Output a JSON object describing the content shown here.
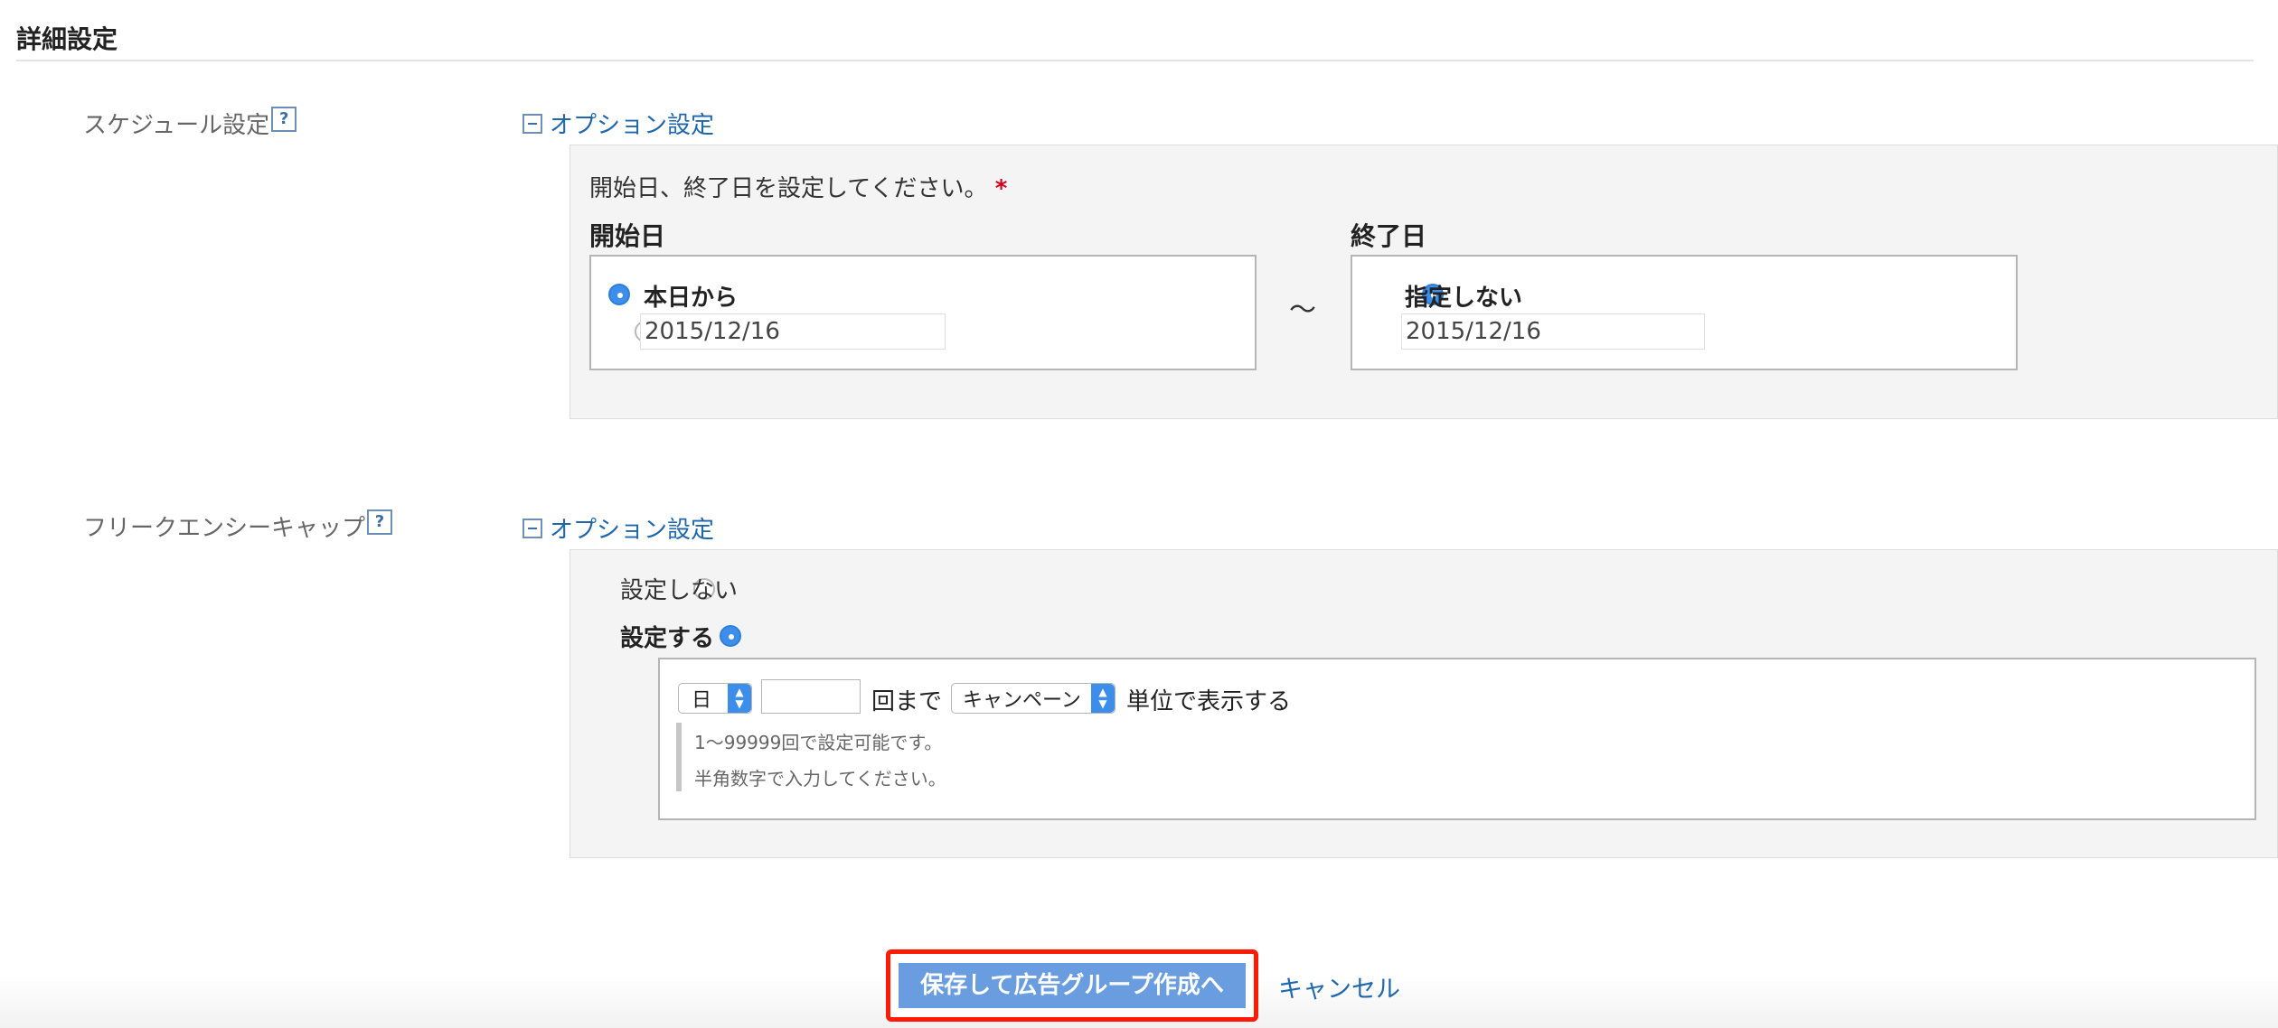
{
  "section_title": "詳細設定",
  "schedule": {
    "label": "スケジュール設定",
    "help": "?",
    "toggle_label": "オプション設定",
    "instruction": "開始日、終了日を設定してください。",
    "required_mark": "*",
    "start": {
      "heading": "開始日",
      "option_today": "本日から",
      "date_value": "2015/12/16",
      "selected": "today"
    },
    "separator": "～",
    "end": {
      "heading": "終了日",
      "option_none": "指定しない",
      "date_value": "2015/12/16",
      "selected": "none"
    }
  },
  "frequency_cap": {
    "label": "フリークエンシーキャップ",
    "help": "?",
    "toggle_label": "オプション設定",
    "option_off": "設定しない",
    "option_on": "設定する",
    "selected": "on",
    "period_select": "日",
    "count_value": "",
    "count_suffix": "回まで",
    "unit_select": "キャンペーン",
    "unit_suffix": "単位で表示する",
    "notes": [
      "1～99999回で設定可能です。",
      "半角数字で入力してください。"
    ]
  },
  "footer": {
    "save_label": "保存して広告グループ作成へ",
    "cancel_label": "キャンセル"
  },
  "colors": {
    "link": "#1f66ad",
    "primary_button": "#6a9ce0",
    "highlight_border": "#ff1a00",
    "required": "#d0021b",
    "radio_selected": "#3d8eea"
  }
}
